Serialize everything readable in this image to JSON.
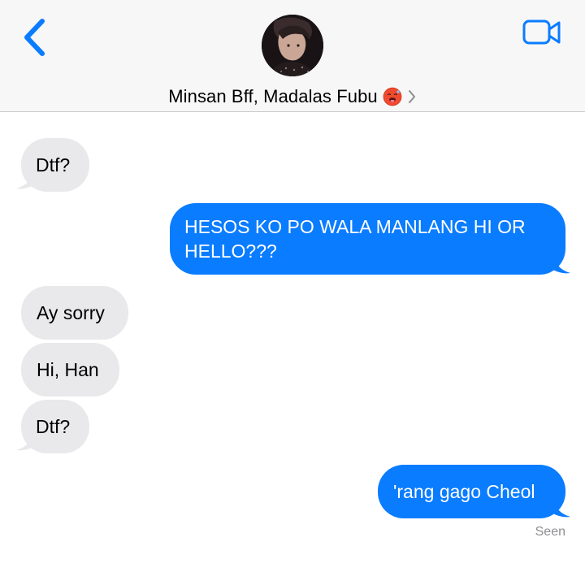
{
  "header": {
    "contact_name": "Minsan Bff, Madalas Fubu",
    "back_icon": "chevron-left-icon",
    "video_icon": "video-camera-icon",
    "emoji_icon": "hot-face-emoji"
  },
  "messages": [
    {
      "from": "them",
      "text": "Dtf?"
    },
    {
      "from": "me",
      "text": "HESOS KO PO WALA MANLANG HI OR HELLO???"
    },
    {
      "from": "them",
      "text": "Ay sorry"
    },
    {
      "from": "them",
      "text": "Hi, Han"
    },
    {
      "from": "them",
      "text": "Dtf?"
    },
    {
      "from": "me",
      "text": "'rang gago Cheol"
    }
  ],
  "status": {
    "seen_label": "Seen"
  },
  "colors": {
    "accent": "#0a7cff",
    "incoming_bubble": "#e9e9eb",
    "header_bg": "#f7f7f7"
  }
}
